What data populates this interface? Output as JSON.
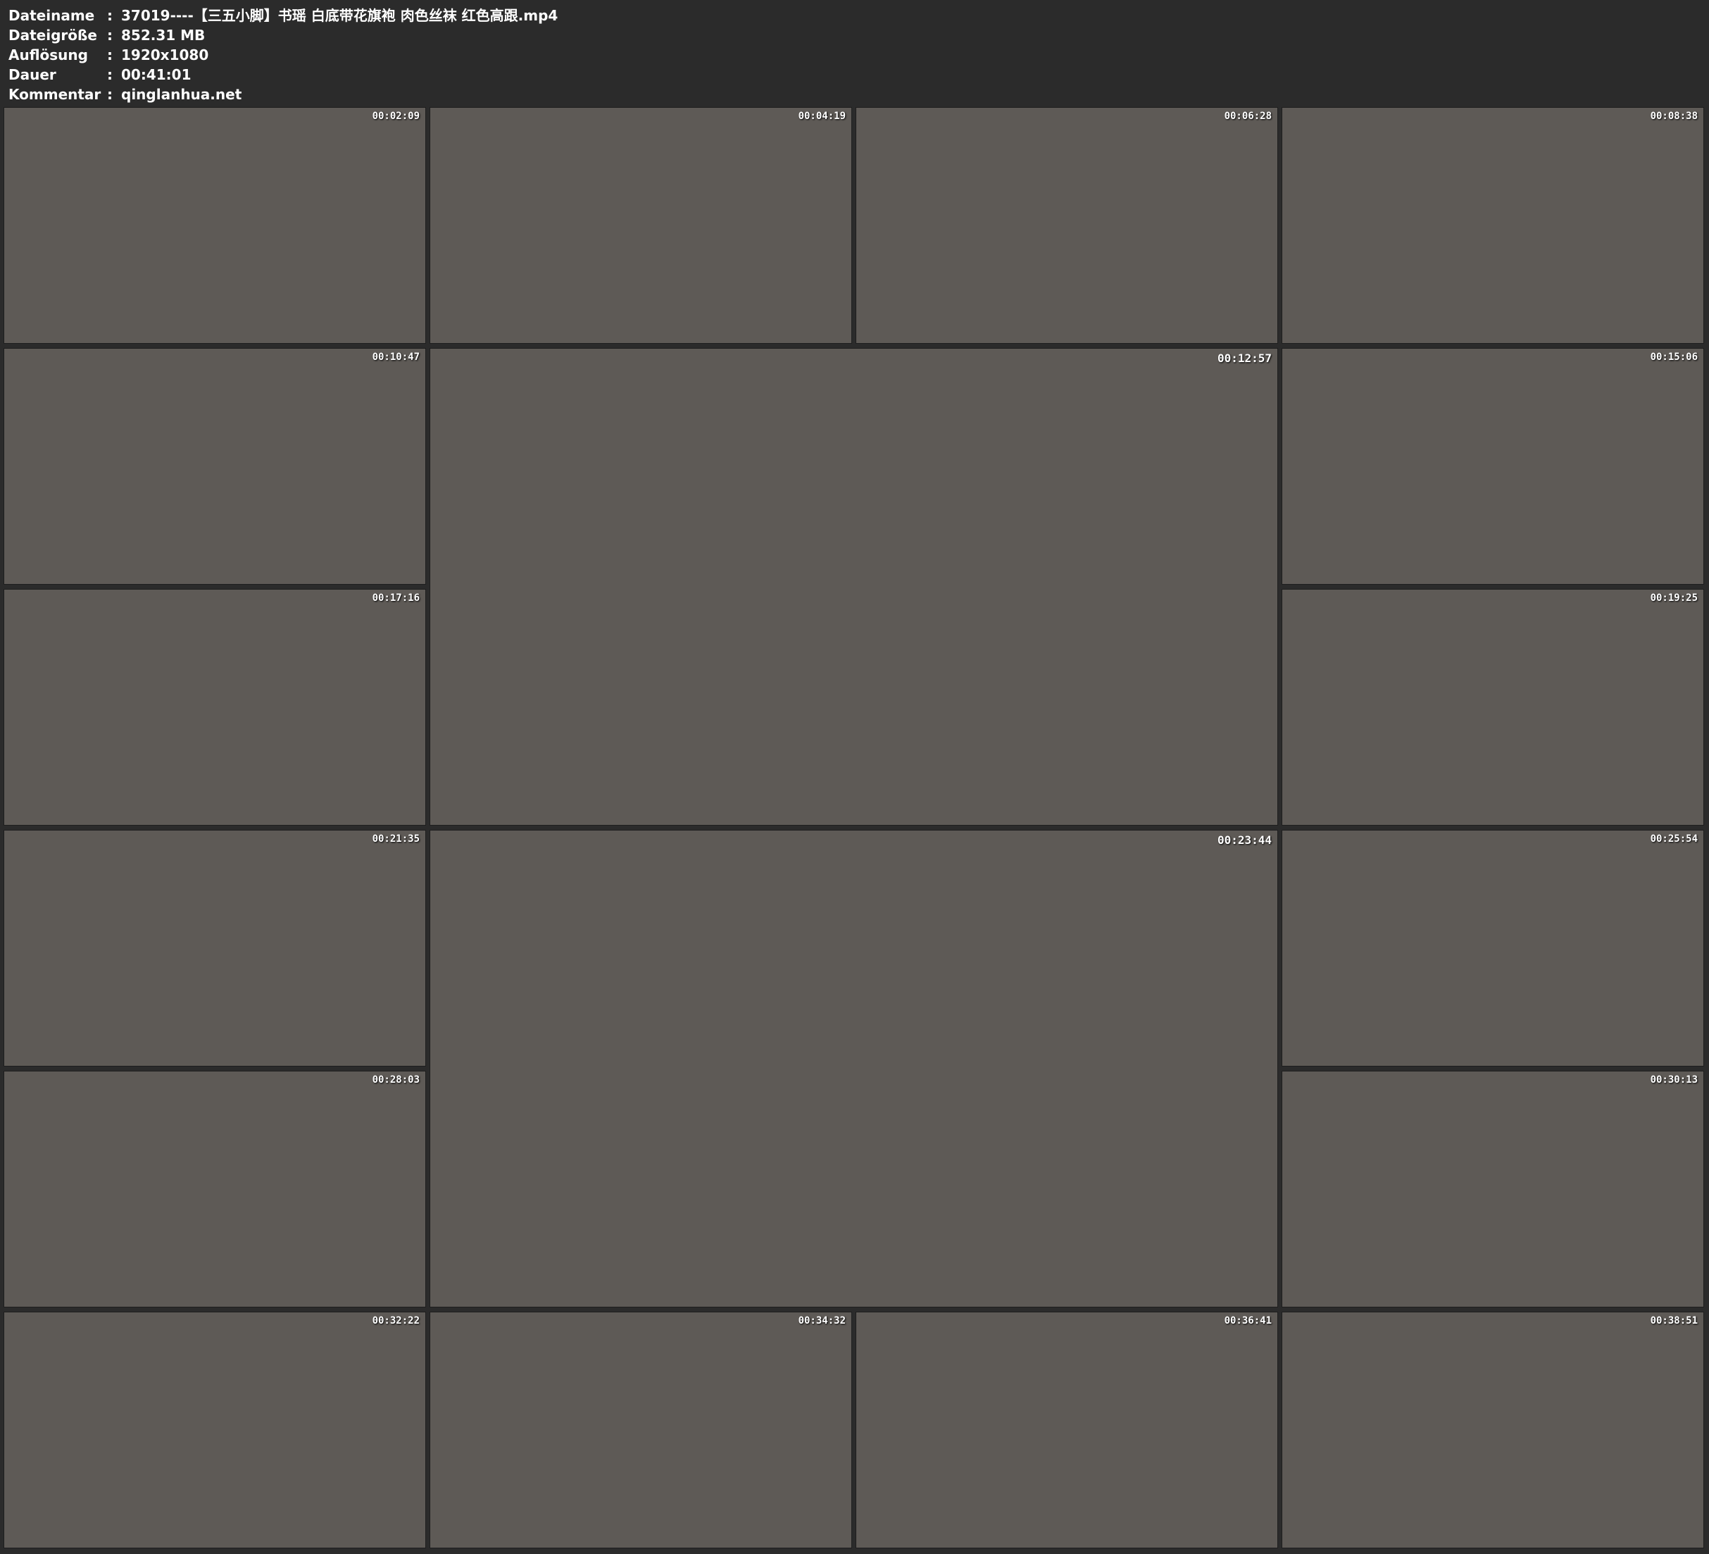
{
  "metadata": [
    {
      "key": "Dateiname",
      "value": "37019----【三五小脚】书瑶 白底带花旗袍 肉色丝袜 红色高跟.mp4"
    },
    {
      "key": "Dateigröße",
      "value": "852.31 MB"
    },
    {
      "key": "Auflösung",
      "value": "1920x1080"
    },
    {
      "key": "Dauer",
      "value": "00:41:01"
    },
    {
      "key": "Kommentar",
      "value": "qinglanhua.net"
    }
  ],
  "separator": ":",
  "thumbnails": [
    {
      "time": "00:02:09"
    },
    {
      "time": "00:04:19"
    },
    {
      "time": "00:06:28"
    },
    {
      "time": "00:08:38"
    },
    {
      "time": "00:10:47"
    },
    {
      "time": "00:12:57"
    },
    {
      "time": "00:15:06"
    },
    {
      "time": "00:17:16"
    },
    {
      "time": "00:19:25"
    },
    {
      "time": "00:21:35"
    },
    {
      "time": "00:23:44"
    },
    {
      "time": "00:25:54"
    },
    {
      "time": "00:28:03"
    },
    {
      "time": "00:30:13"
    },
    {
      "time": "00:32:22"
    },
    {
      "time": "00:34:32"
    },
    {
      "time": "00:36:41"
    },
    {
      "time": "00:38:51"
    }
  ]
}
